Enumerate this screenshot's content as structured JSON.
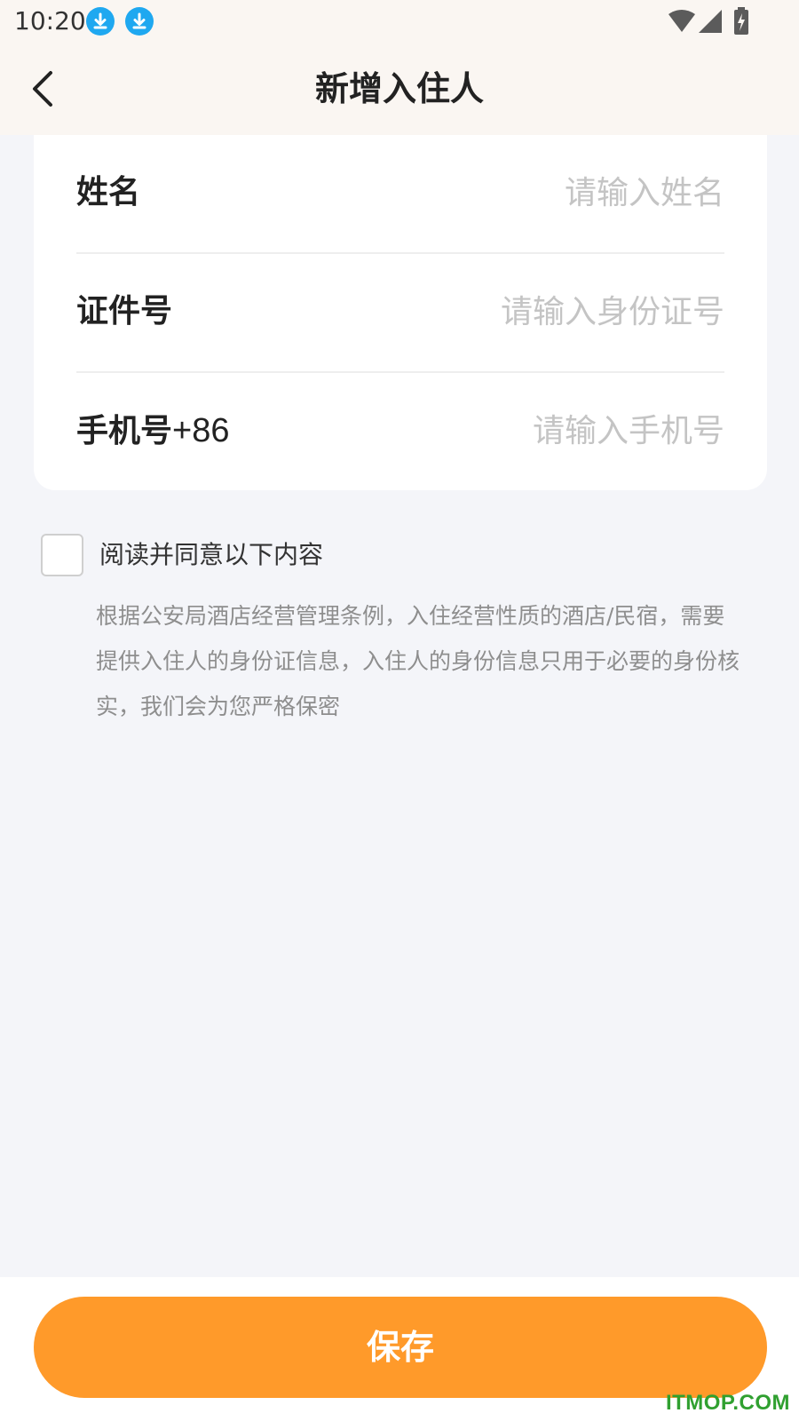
{
  "status_bar": {
    "time": "10:20",
    "icons": [
      "download-icon",
      "download-icon",
      "wifi-icon",
      "signal-icon",
      "battery-charging-icon"
    ]
  },
  "header": {
    "title": "新增入住人",
    "back_icon": "chevron-left-icon"
  },
  "form": {
    "fields": [
      {
        "label": "姓名",
        "prefix": "",
        "value": "",
        "placeholder": "请输入姓名"
      },
      {
        "label": "证件号",
        "prefix": "",
        "value": "",
        "placeholder": "请输入身份证号"
      },
      {
        "label": "手机号",
        "prefix": "+86",
        "value": "",
        "placeholder": "请输入手机号"
      }
    ]
  },
  "agreement": {
    "checked": false,
    "label": "阅读并同意以下内容",
    "notice": "根据公安局酒店经营管理条例，入住经营性质的酒店/民宿，需要提供入住人的身份证信息，入住人的身份信息只用于必要的身份核实，我们会为您严格保密"
  },
  "footer": {
    "save_label": "保存"
  },
  "watermark": "ITMOP.COM",
  "colors": {
    "accent": "#ff9a2a",
    "header_bg": "#faf6f2",
    "page_bg": "#f4f5f9",
    "download_badge": "#1fa8f0",
    "watermark": "#30a030"
  }
}
